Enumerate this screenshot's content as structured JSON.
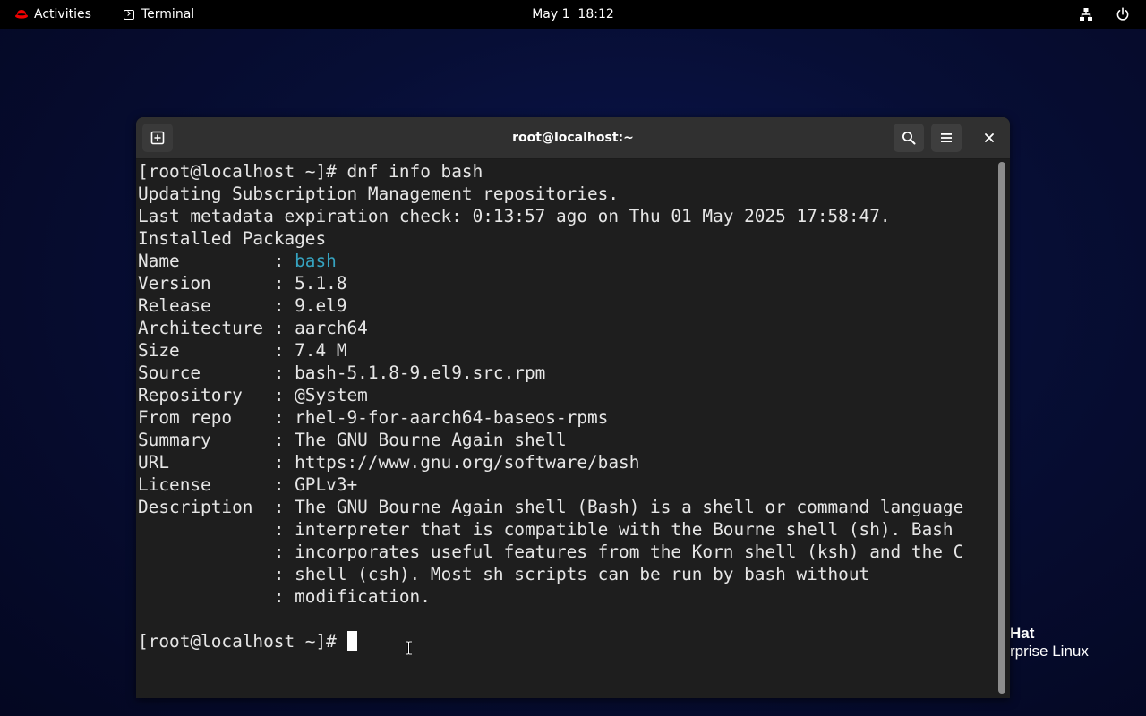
{
  "topbar": {
    "activities_label": "Activities",
    "app_label": "Terminal",
    "clock": "May 1  18:12"
  },
  "brand": {
    "line1": "Hat",
    "line2": "rprise Linux"
  },
  "window": {
    "title": "root@localhost:~"
  },
  "terminal": {
    "lines": [
      "[root@localhost ~]# dnf info bash",
      "Updating Subscription Management repositories.",
      "Last metadata expiration check: 0:13:57 ago on Thu 01 May 2025 17:58:47.",
      "Installed Packages"
    ],
    "info": [
      {
        "key": "Name         ",
        "value": "bash",
        "highlight": true
      },
      {
        "key": "Version      ",
        "value": "5.1.8"
      },
      {
        "key": "Release      ",
        "value": "9.el9"
      },
      {
        "key": "Architecture ",
        "value": "aarch64"
      },
      {
        "key": "Size         ",
        "value": "7.4 M"
      },
      {
        "key": "Source       ",
        "value": "bash-5.1.8-9.el9.src.rpm"
      },
      {
        "key": "Repository   ",
        "value": "@System"
      },
      {
        "key": "From repo    ",
        "value": "rhel-9-for-aarch64-baseos-rpms"
      },
      {
        "key": "Summary      ",
        "value": "The GNU Bourne Again shell"
      },
      {
        "key": "URL          ",
        "value": "https://www.gnu.org/software/bash"
      },
      {
        "key": "License      ",
        "value": "GPLv3+"
      },
      {
        "key": "Description  ",
        "value": "The GNU Bourne Again shell (Bash) is a shell or command language"
      },
      {
        "key": "             ",
        "value": "interpreter that is compatible with the Bourne shell (sh). Bash"
      },
      {
        "key": "             ",
        "value": "incorporates useful features from the Korn shell (ksh) and the C"
      },
      {
        "key": "             ",
        "value": "shell (csh). Most sh scripts can be run by bash without"
      },
      {
        "key": "             ",
        "value": "modification."
      }
    ],
    "separator": ": ",
    "prompt": "[root@localhost ~]# "
  }
}
